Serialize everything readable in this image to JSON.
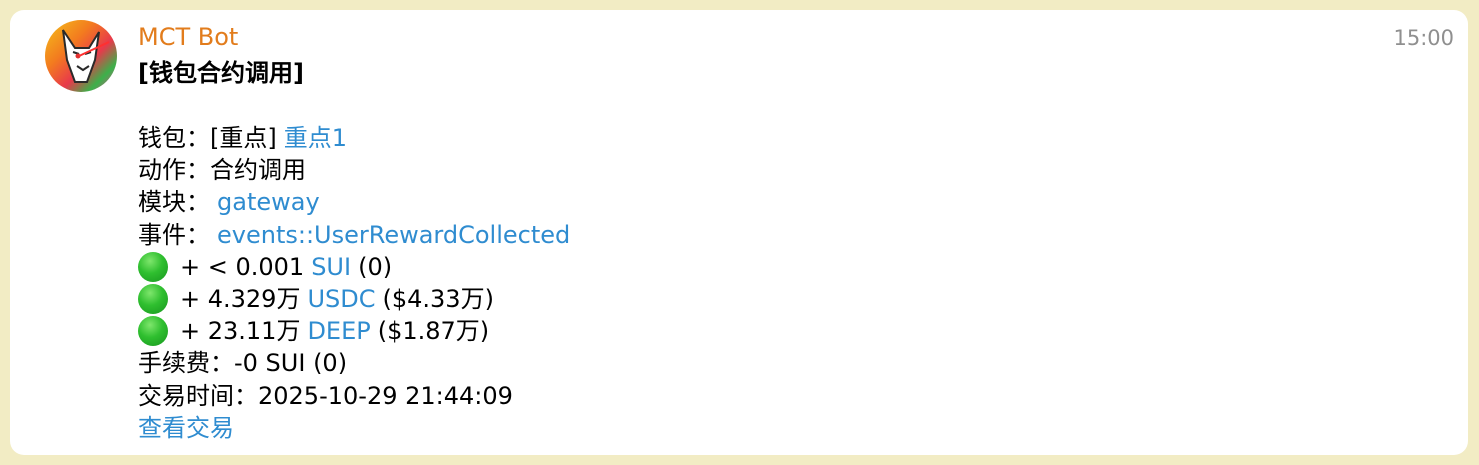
{
  "message": {
    "sender": "MCT Bot",
    "time": "15:00",
    "title": "[钱包合约调用]"
  },
  "lines": {
    "wallet_label": "钱包：",
    "wallet_tag": "[重点]",
    "wallet_name": "重点1",
    "action_label": "动作：",
    "action_value": "合约调用",
    "module_label": "模块：",
    "module_value": "gateway",
    "event_label": "事件：",
    "event_value": "events::UserRewardCollected",
    "transfers": [
      {
        "amount": "+ < 0.001",
        "token": "SUI",
        "value": "(0)"
      },
      {
        "amount": "+ 4.329万",
        "token": "USDC",
        "value": "($4.33万)"
      },
      {
        "amount": "+ 23.11万",
        "token": "DEEP",
        "value": "($1.87万)"
      }
    ],
    "fee_label": "手续费：",
    "fee_value": "-0 SUI (0)",
    "tx_time_label": "交易时间：",
    "tx_time_value": "2025-10-29 21:44:09",
    "view_tx": "查看交易"
  },
  "colors": {
    "background": "#f2ecc4",
    "sender": "#e27c1c",
    "link": "#2f8cd0",
    "time": "#8f8f8f",
    "status_dot": "#2fbf2f"
  },
  "icons": {
    "avatar": "fox-mascot-avatar",
    "status": "green-circle"
  }
}
